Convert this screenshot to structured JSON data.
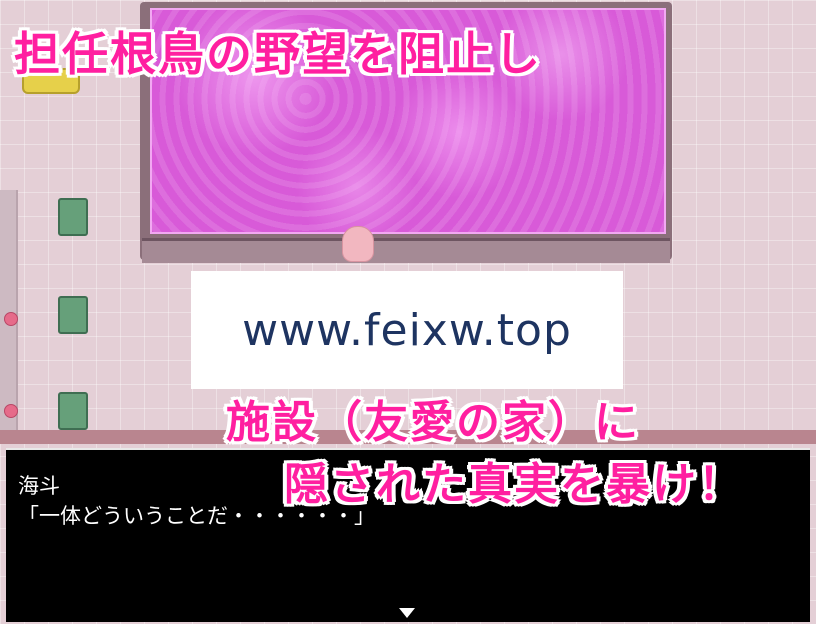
{
  "captions": {
    "top": "担任根鳥の野望を阻止し",
    "middle": "施設（友愛の家）に",
    "bottom": "隠された真実を暴け！"
  },
  "watermark": {
    "text": "www.feixw.top"
  },
  "dialog": {
    "speaker": "海斗",
    "message": "「一体どういうことだ・・・・・・」"
  },
  "colors": {
    "caption": "#ff1fa0",
    "pool": "#d85ad8",
    "dialog_bg": "#000000",
    "watermark_text": "#1e3461"
  }
}
